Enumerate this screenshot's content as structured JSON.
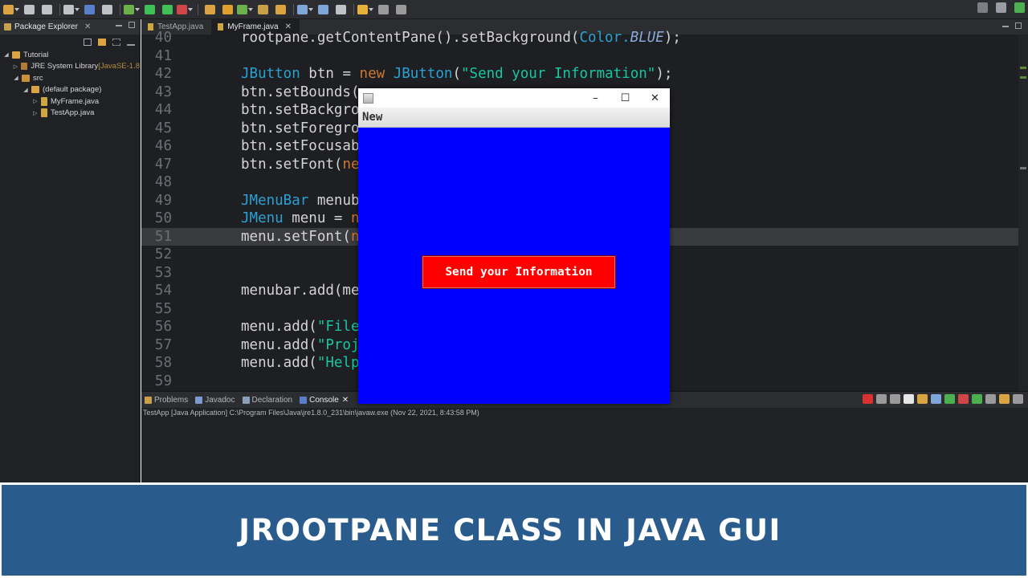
{
  "toolbar": {
    "icons": [
      "new-icon",
      "save-icon",
      "save-all-icon",
      "print-icon",
      "terminal-icon",
      "link-icon",
      "debug-icon",
      "run-icon",
      "coverage-icon",
      "external-tools-icon",
      "new-java-project-icon",
      "new-package-icon",
      "new-class-icon",
      "open-type-icon",
      "search-icon",
      "toggle-mark-icon",
      "toggle-block-icon",
      "show-whitespace-icon",
      "back-icon",
      "forward-icon",
      "pin-icon"
    ],
    "accent": "#4caf50"
  },
  "package_explorer": {
    "title": "Package Explorer",
    "tree": [
      {
        "label": "Tutorial",
        "decoration": "",
        "level": 0,
        "expanded": true,
        "icon": "project-icon"
      },
      {
        "label": "JRE System Library",
        "decoration": "[JavaSE-1.8",
        "level": 1,
        "expanded": false,
        "icon": "library-icon"
      },
      {
        "label": "src",
        "decoration": "",
        "level": 1,
        "expanded": true,
        "icon": "source-folder-icon"
      },
      {
        "label": "(default package)",
        "decoration": "",
        "level": 2,
        "expanded": true,
        "icon": "package-icon"
      },
      {
        "label": "MyFrame.java",
        "decoration": "",
        "level": 3,
        "expanded": false,
        "icon": "java-file-icon"
      },
      {
        "label": "TestApp.java",
        "decoration": "",
        "level": 3,
        "expanded": false,
        "icon": "java-file-icon"
      }
    ]
  },
  "editor": {
    "tabs": [
      {
        "label": "TestApp.java",
        "active": false
      },
      {
        "label": "MyFrame.java",
        "active": true
      }
    ],
    "current_line": 51,
    "lines": [
      {
        "n": "40",
        "tokens": [
          [
            "rootpane.getContentPane().setBackground(",
            ""
          ],
          [
            "Color.",
            "ty"
          ],
          [
            "BLUE",
            "fd"
          ],
          [
            ");",
            ""
          ]
        ]
      },
      {
        "n": "41",
        "tokens": []
      },
      {
        "n": "42",
        "tokens": [
          [
            "JButton",
            "ty"
          ],
          [
            " btn = ",
            ""
          ],
          [
            "new",
            "kw"
          ],
          [
            " ",
            ""
          ],
          [
            "JButton",
            "ty"
          ],
          [
            "(",
            ""
          ],
          [
            "\"Send your Information\"",
            "st"
          ],
          [
            ");",
            ""
          ]
        ]
      },
      {
        "n": "43",
        "tokens": [
          [
            "btn.setBounds(",
            ""
          ]
        ]
      },
      {
        "n": "44",
        "tokens": [
          [
            "btn.setBackgro",
            ""
          ]
        ]
      },
      {
        "n": "45",
        "tokens": [
          [
            "btn.setForegro",
            ""
          ]
        ]
      },
      {
        "n": "46",
        "tokens": [
          [
            "btn.setFocusab",
            ""
          ]
        ]
      },
      {
        "n": "47",
        "tokens": [
          [
            "btn.setFont(",
            ""
          ],
          [
            "ne",
            "kw"
          ]
        ]
      },
      {
        "n": "48",
        "tokens": []
      },
      {
        "n": "49",
        "tokens": [
          [
            "JMenuBar",
            "ty"
          ],
          [
            " menub",
            ""
          ]
        ]
      },
      {
        "n": "50",
        "tokens": [
          [
            "JMenu",
            "ty"
          ],
          [
            " menu = ",
            ""
          ],
          [
            "n",
            "kw"
          ]
        ]
      },
      {
        "n": "51",
        "tokens": [
          [
            "menu.setFont(",
            ""
          ],
          [
            "n",
            "kw"
          ]
        ]
      },
      {
        "n": "52",
        "tokens": []
      },
      {
        "n": "53",
        "tokens": []
      },
      {
        "n": "54",
        "tokens": [
          [
            "menubar.add(me",
            ""
          ]
        ]
      },
      {
        "n": "55",
        "tokens": []
      },
      {
        "n": "56",
        "tokens": [
          [
            "menu.add(",
            ""
          ],
          [
            "\"File",
            "st"
          ]
        ]
      },
      {
        "n": "57",
        "tokens": [
          [
            "menu.add(",
            ""
          ],
          [
            "\"Proj",
            "st"
          ]
        ]
      },
      {
        "n": "58",
        "tokens": [
          [
            "menu.add(",
            ""
          ],
          [
            "\"Help",
            "st"
          ]
        ]
      },
      {
        "n": "59",
        "tokens": []
      }
    ]
  },
  "console": {
    "tabs": [
      {
        "label": "Problems",
        "active": false,
        "icon": "problems-icon"
      },
      {
        "label": "Javadoc",
        "active": false,
        "icon": "javadoc-icon"
      },
      {
        "label": "Declaration",
        "active": false,
        "icon": "declaration-icon"
      },
      {
        "label": "Console",
        "active": true,
        "icon": "console-icon"
      }
    ],
    "status": "TestApp [Java Application] C:\\Program Files\\Java\\jre1.8.0_231\\bin\\javaw.exe (Nov 22, 2021, 8:43:58 PM)"
  },
  "swing_window": {
    "menu_label": "New",
    "button_label": "Send your Information",
    "controls": {
      "minimize": "–",
      "maximize": "☐",
      "close": "✕"
    },
    "background": "#0000ff",
    "button_color": "#ff0000"
  },
  "banner": {
    "title": "JROOTPANE CLASS IN JAVA GUI",
    "background": "#295b8c"
  }
}
